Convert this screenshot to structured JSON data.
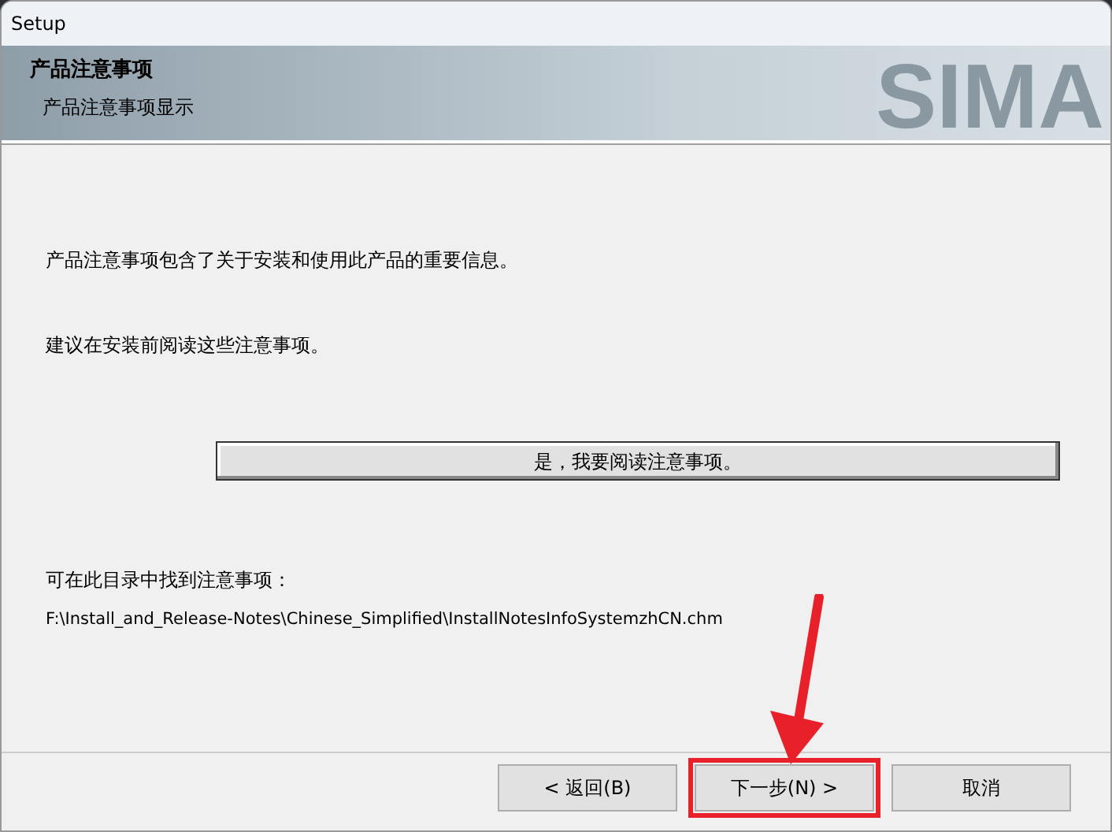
{
  "window": {
    "title": "Setup"
  },
  "header": {
    "title": "产品注意事项",
    "subtitle": "产品注意事项显示",
    "logo_text": "SIMA"
  },
  "body": {
    "paragraphs": [
      "产品注意事项包含了关于安装和使用此产品的重要信息。",
      "建议在安装前阅读这些注意事项。"
    ],
    "read_button": "是，我要阅读注意事项。",
    "location_label": "可在此目录中找到注意事项：",
    "path": "F:\\Install_and_Release-Notes\\Chinese_Simplified\\InstallNotesInfoSystemzhCN.chm"
  },
  "buttons": [
    {
      "label": "< 返回(B)",
      "highlighted": false
    },
    {
      "label": "下一步(N) >",
      "highlighted": true
    },
    {
      "label": "取消",
      "highlighted": false
    }
  ],
  "annotation_arrow": true
}
